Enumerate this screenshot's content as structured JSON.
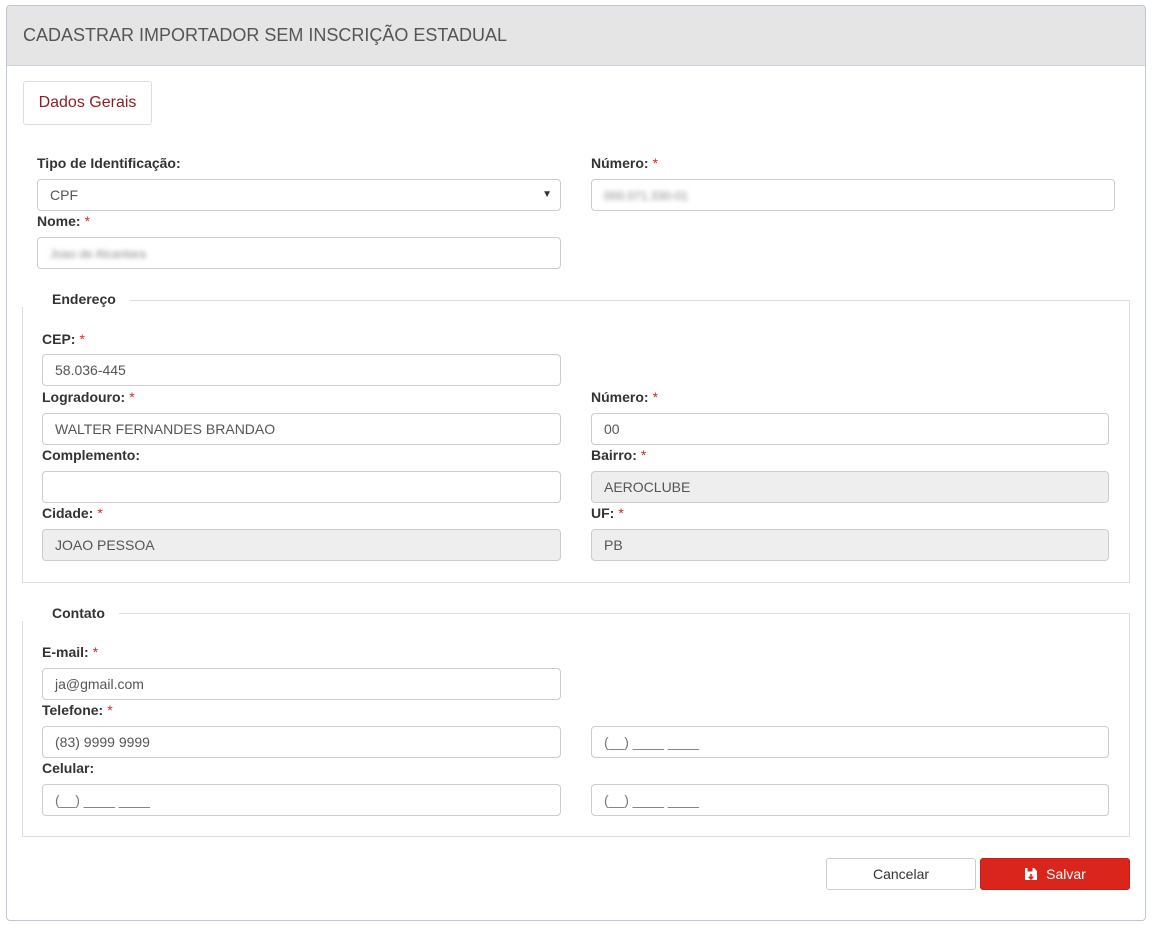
{
  "header": {
    "title": "CADASTRAR IMPORTADOR SEM INSCRIÇÃO ESTADUAL"
  },
  "tabs": [
    {
      "label": "Dados Gerais"
    }
  ],
  "required_marker": "*",
  "general": {
    "tipo_label": "Tipo de Identificação:",
    "tipo_value": "CPF",
    "numero_label": "Número:",
    "numero_value": "000.071.330-01",
    "nome_label": "Nome:",
    "nome_value": "Joao de Alcantara"
  },
  "address": {
    "legend": "Endereço",
    "cep_label": "CEP:",
    "cep_value": "58.036-445",
    "logradouro_label": "Logradouro:",
    "logradouro_value": "WALTER FERNANDES BRANDAO",
    "numero_label": "Número:",
    "numero_value": "00",
    "complemento_label": "Complemento:",
    "complemento_value": "",
    "bairro_label": "Bairro:",
    "bairro_value": "AEROCLUBE",
    "cidade_label": "Cidade:",
    "cidade_value": "JOAO PESSOA",
    "uf_label": "UF:",
    "uf_value": "PB"
  },
  "contact": {
    "legend": "Contato",
    "email_label": "E-mail:",
    "email_value": "ja@gmail.com",
    "telefone_label": "Telefone:",
    "telefone_value": "(83) 9999 9999",
    "telefone2_mask": "(__) ____ ____",
    "celular_label": "Celular:",
    "celular_mask": "(__) ____ ____",
    "celular2_mask": "(__) ____ ____"
  },
  "actions": {
    "cancel_label": "Cancelar",
    "save_label": "Salvar"
  },
  "icons": {
    "save": "save-icon",
    "dropdown": "caret-down-icon"
  },
  "colors": {
    "accent": "#d9251b",
    "tab_text": "#8b1e1e",
    "required": "#d9281f"
  }
}
